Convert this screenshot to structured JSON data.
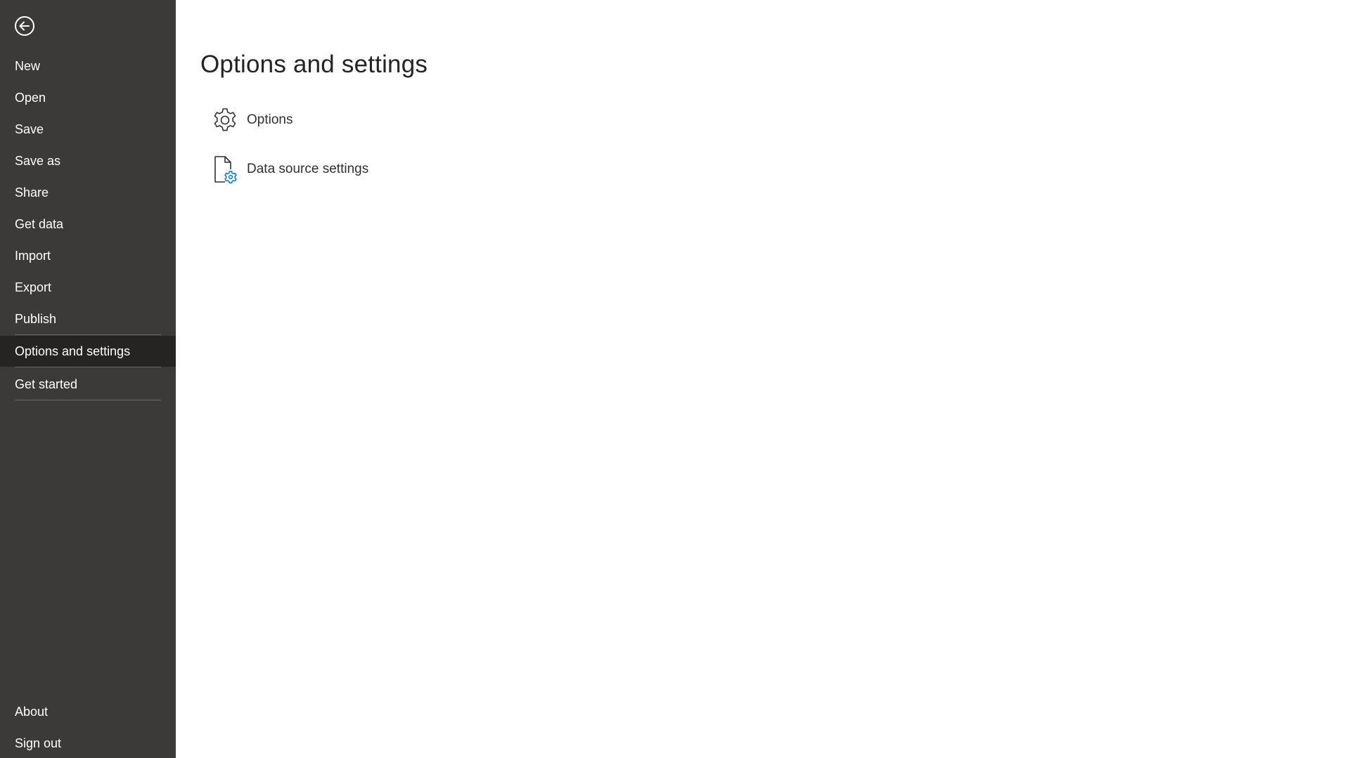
{
  "sidebar": {
    "back_icon": "back-arrow-icon",
    "items": [
      {
        "label": "New"
      },
      {
        "label": "Open"
      },
      {
        "label": "Save"
      },
      {
        "label": "Save as"
      },
      {
        "label": "Share"
      },
      {
        "label": "Get data"
      },
      {
        "label": "Import"
      },
      {
        "label": "Export"
      },
      {
        "label": "Publish"
      },
      {
        "label": "Options and settings",
        "selected": true
      },
      {
        "label": "Get started"
      }
    ],
    "bottom_items": [
      {
        "label": "About"
      },
      {
        "label": "Sign out"
      }
    ]
  },
  "main": {
    "title": "Options and settings",
    "options": [
      {
        "label": "Options",
        "icon": "gear-icon"
      },
      {
        "label": "Data source settings",
        "icon": "data-source-settings-icon"
      }
    ]
  },
  "colors": {
    "sidebar_bg": "#3b3a39",
    "selected_bg": "#252423",
    "accent_blue": "#0078d4"
  }
}
